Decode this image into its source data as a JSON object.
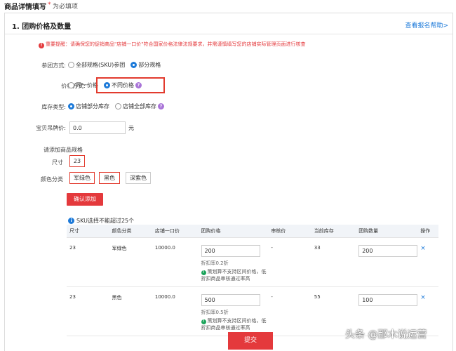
{
  "header": {
    "title": "商品详情填写",
    "required_star": "*",
    "required_text": "为必填项"
  },
  "section": {
    "title": "1. 团购价格及数量",
    "help_link": "查看报名帮助>"
  },
  "notice": {
    "icon": "!",
    "text": "重要提醒：请确保您的促销商品\"店铺一口价\"符合国家价格法律法规要求，并需谨慎填写您的店铺实际管理页面进行核查"
  },
  "participation": {
    "label": "参团方式:",
    "options": [
      "全部规格(SKU)参团",
      "部分规格"
    ],
    "selected_index": 1
  },
  "price_mode": {
    "label": "价格方式:",
    "options": [
      "同一价格",
      "不同价格"
    ],
    "selected_index": 1,
    "help_icon": "?"
  },
  "stock_type": {
    "label": "库存类型:",
    "options": [
      "店铺部分库存",
      "店铺全部库存"
    ],
    "selected_index": 0,
    "help_icon": "?"
  },
  "retail_price": {
    "label": "宝贝吊牌价:",
    "value": "0.0",
    "unit": "元"
  },
  "spec": {
    "label": "请添加商品规格",
    "size_label": "尺寸",
    "size_value": "23",
    "color_label": "颜色分类",
    "colors": [
      "军绿色",
      "黑色",
      "深紫色"
    ],
    "colors_selected": [
      true,
      true,
      false
    ]
  },
  "confirm_button": "确认添加",
  "sku_info": {
    "icon": "i",
    "text": "SKU选择不能超过25个"
  },
  "table": {
    "headers": [
      "尺寸",
      "颜色分类",
      "店铺一口价",
      "团购价格",
      "审核价",
      "当前库存",
      "团购数量",
      "操作"
    ],
    "tip_icon": "!",
    "rows": [
      {
        "size": "23",
        "color": "军绿色",
        "shop_price": "10000.0",
        "group_price": "200",
        "discount": "折扣率0.2折",
        "tip": "策划算不支持区间价格，低折扣商品审核通过率高",
        "audit_price": "-",
        "stock": "33",
        "group_qty": "200",
        "action": "×"
      },
      {
        "size": "23",
        "color": "黑色",
        "shop_price": "10000.0",
        "group_price": "500",
        "discount": "折扣率0.5折",
        "tip": "策划算不支持区间价格，低折扣商品审核通过率高",
        "audit_price": "-",
        "stock": "55",
        "group_qty": "100",
        "action": "×"
      }
    ]
  },
  "submit_button": "提交",
  "watermark": "头条 @那木说运营"
}
